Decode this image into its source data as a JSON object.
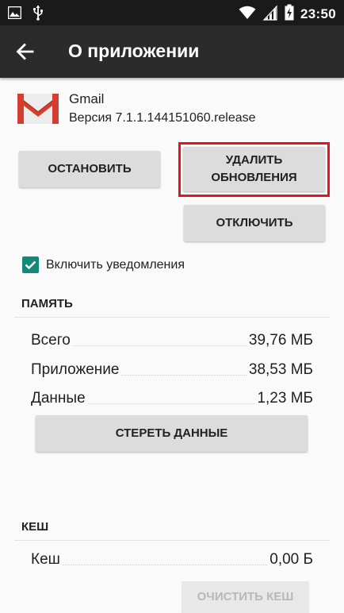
{
  "status_bar": {
    "time": "23:50",
    "left_icons": [
      "image-icon",
      "usb-icon"
    ],
    "right_icons": [
      "wifi-icon",
      "signal-icon",
      "battery-charging-icon"
    ]
  },
  "app_bar": {
    "title": "О приложении",
    "back_icon": "arrow-back-icon"
  },
  "app": {
    "name": "Gmail",
    "version": "Версия 7.1.1.144151060.release",
    "icon": "gmail-icon"
  },
  "buttons": {
    "stop": "ОСТАНОВИТЬ",
    "uninstall_updates_line1": "УДАЛИТЬ",
    "uninstall_updates_line2": "ОБНОВЛЕНИЯ",
    "disable": "ОТКЛЮЧИТЬ",
    "clear_data": "СТЕРЕТЬ ДАННЫЕ",
    "clear_cache": "ОЧИСТИТЬ КЕШ"
  },
  "notifications": {
    "label": "Включить уведомления",
    "checked": true,
    "accent_color": "#12897b"
  },
  "storage": {
    "header": "ПАМЯТЬ",
    "rows": [
      {
        "label": "Всего",
        "value": "39,76 МБ"
      },
      {
        "label": "Приложение",
        "value": "38,53 МБ"
      },
      {
        "label": "Данные",
        "value": "1,23 МБ"
      }
    ]
  },
  "cache": {
    "header": "КЕШ",
    "rows": [
      {
        "label": "Кеш",
        "value": "0,00 Б"
      }
    ]
  },
  "highlight_color": "#e1141f"
}
